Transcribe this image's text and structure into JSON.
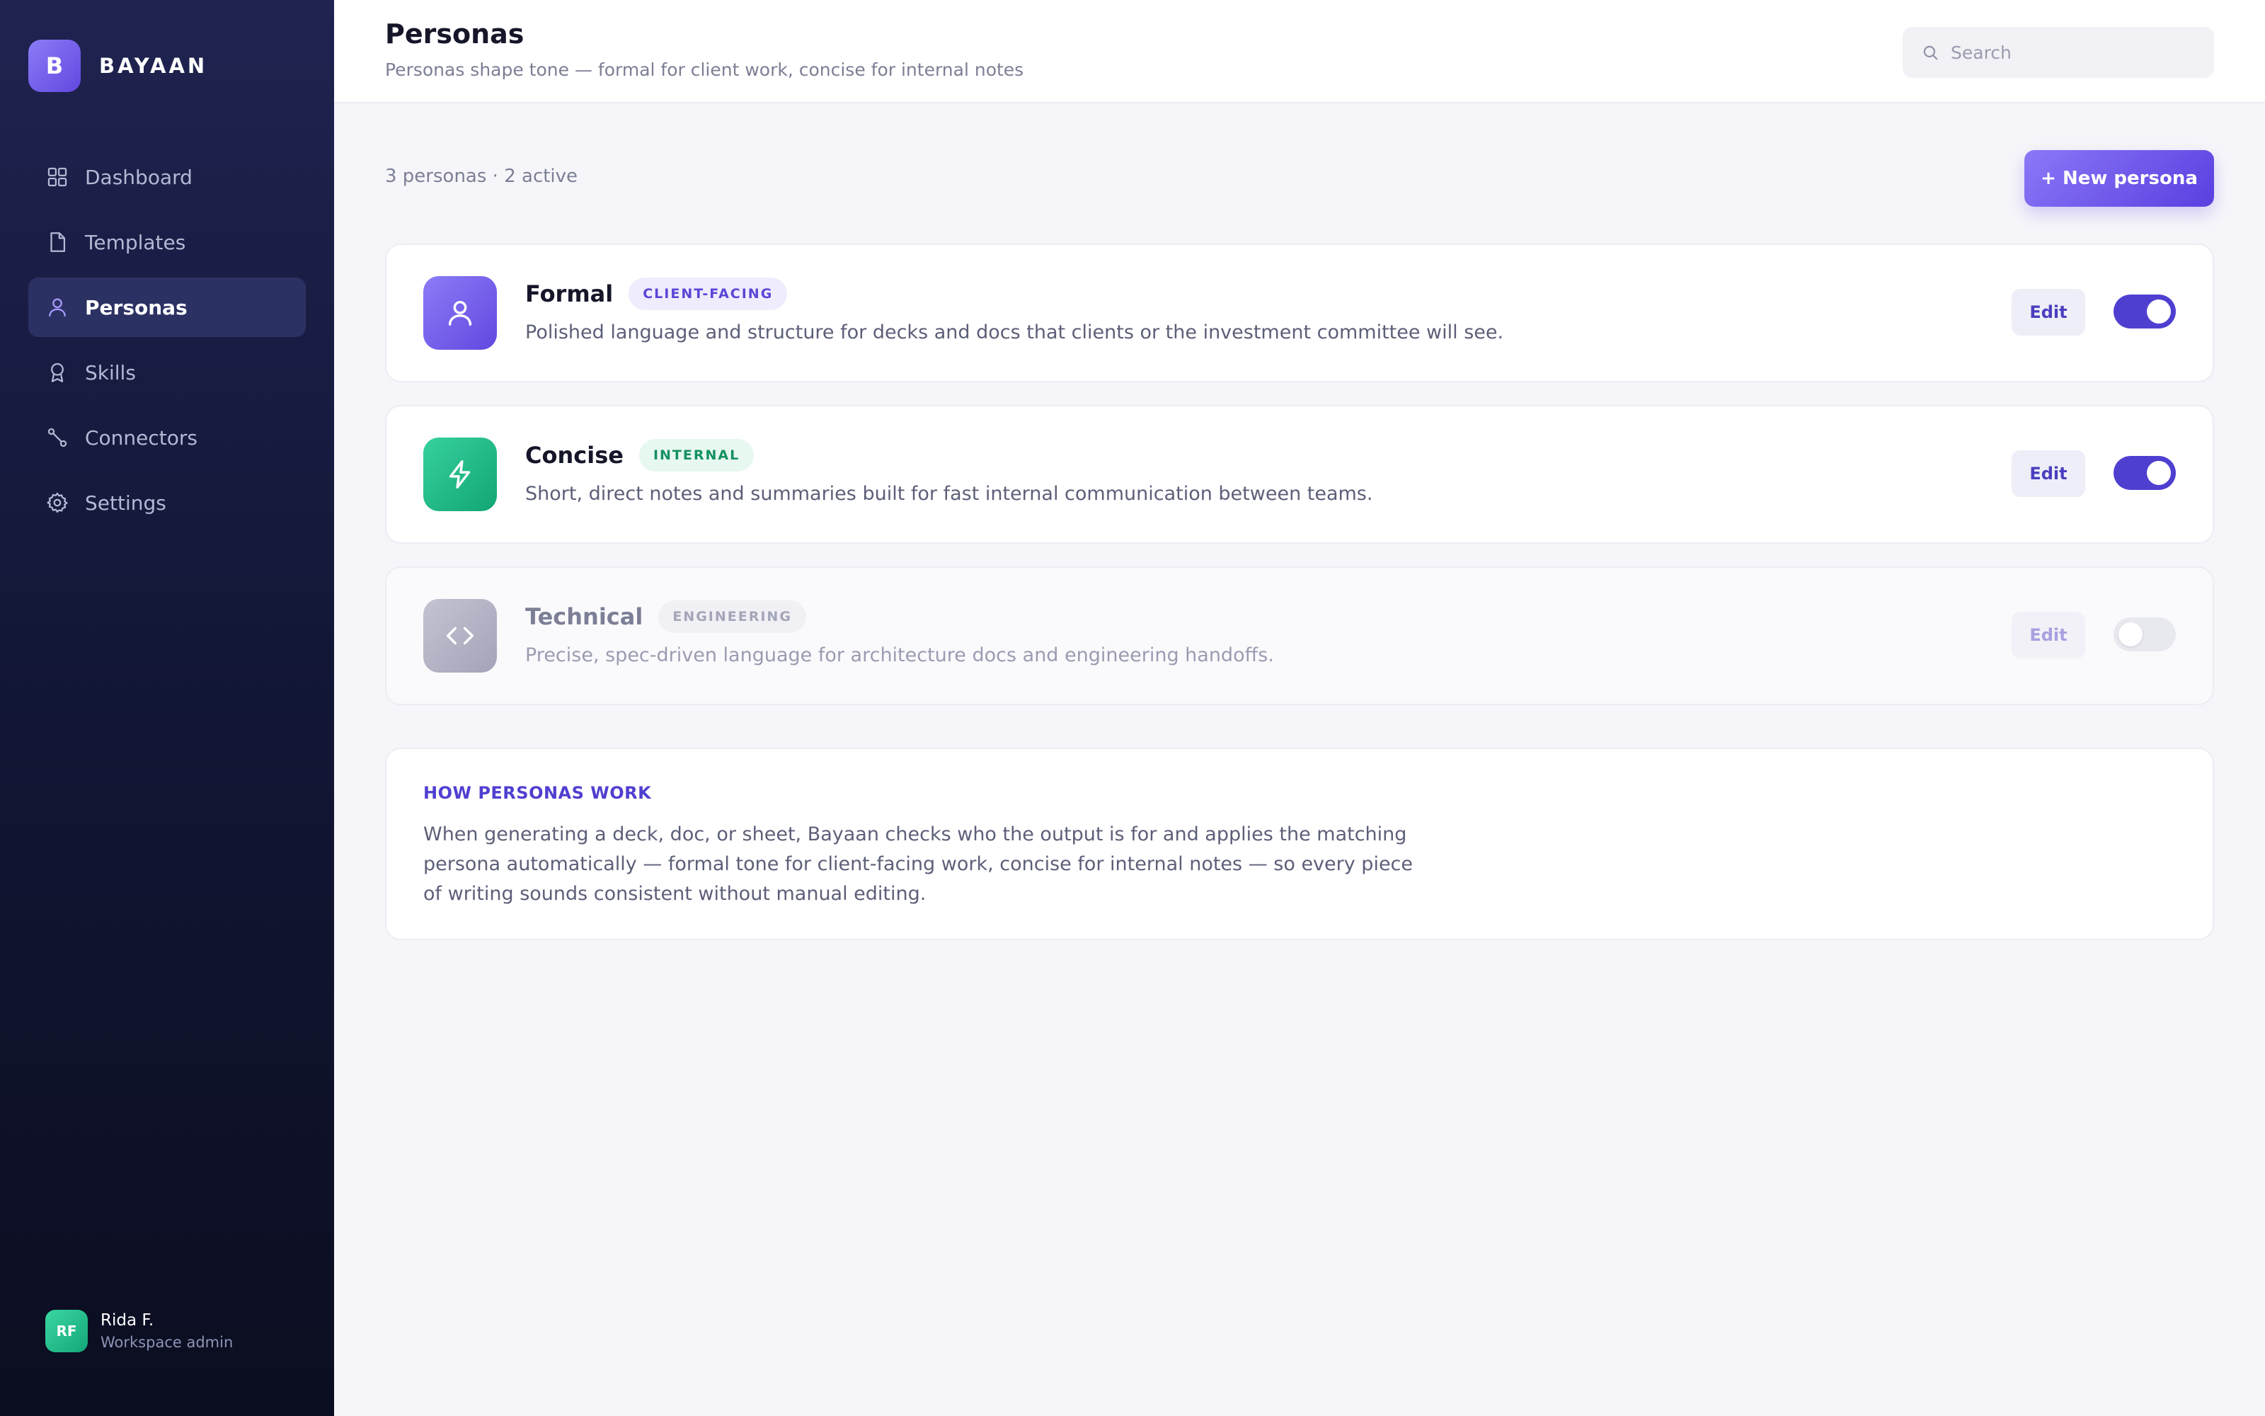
{
  "brand": {
    "mark": "B",
    "name": "BAYAAN"
  },
  "sidebar": {
    "items": [
      {
        "label": "Dashboard",
        "icon": "grid-icon",
        "active": false
      },
      {
        "label": "Templates",
        "icon": "file-icon",
        "active": false
      },
      {
        "label": "Personas",
        "icon": "user-icon",
        "active": true
      },
      {
        "label": "Skills",
        "icon": "award-icon",
        "active": false
      },
      {
        "label": "Connectors",
        "icon": "connector-icon",
        "active": false
      },
      {
        "label": "Settings",
        "icon": "gear-icon",
        "active": false
      }
    ],
    "user": {
      "initials": "RF",
      "name": "Rida F.",
      "role": "Workspace admin"
    }
  },
  "header": {
    "title": "Personas",
    "subtitle": "Personas shape tone — formal for client work, concise for internal notes",
    "search_placeholder": "Search"
  },
  "summary": "3 personas · 2 active",
  "new_button_label": "+ New persona",
  "personas": [
    {
      "name": "Formal",
      "tag": "CLIENT-FACING",
      "description": "Polished language and structure for decks and docs that clients or the investment committee will see.",
      "icon": "user-icon",
      "edit_label": "Edit",
      "enabled": true,
      "icon_gradient": [
        "#8b7cf6",
        "#6248e0"
      ],
      "tag_bg": "#efecfd",
      "tag_color": "#5a46d6"
    },
    {
      "name": "Concise",
      "tag": "INTERNAL",
      "description": "Short, direct notes and summaries built for fast internal communication between teams.",
      "icon": "bolt-icon",
      "edit_label": "Edit",
      "enabled": true,
      "icon_gradient": [
        "#36d19e",
        "#12a574"
      ],
      "tag_bg": "#e7f8f0",
      "tag_color": "#14915f"
    },
    {
      "name": "Technical",
      "tag": "ENGINEERING",
      "description": "Precise, spec-driven language for architecture docs and engineering handoffs.",
      "icon": "code-icon",
      "edit_label": "Edit",
      "enabled": false,
      "icon_gradient": [
        "#c3c3d2",
        "#a4a4b9"
      ],
      "tag_bg": "#f0f0f5",
      "tag_color": "#a4a6b8"
    }
  ],
  "info": {
    "title": "HOW PERSONAS WORK",
    "body": "When generating a deck, doc, or sheet, Bayaan checks who the output is for and applies the matching persona automatically — formal tone for client-facing work, concise for internal notes — so every piece of writing sounds consistent without manual editing."
  },
  "colors": {
    "accent": "#4f3fd0",
    "sidebar_bg": "#131737",
    "page_bg": "#f6f6fa"
  }
}
